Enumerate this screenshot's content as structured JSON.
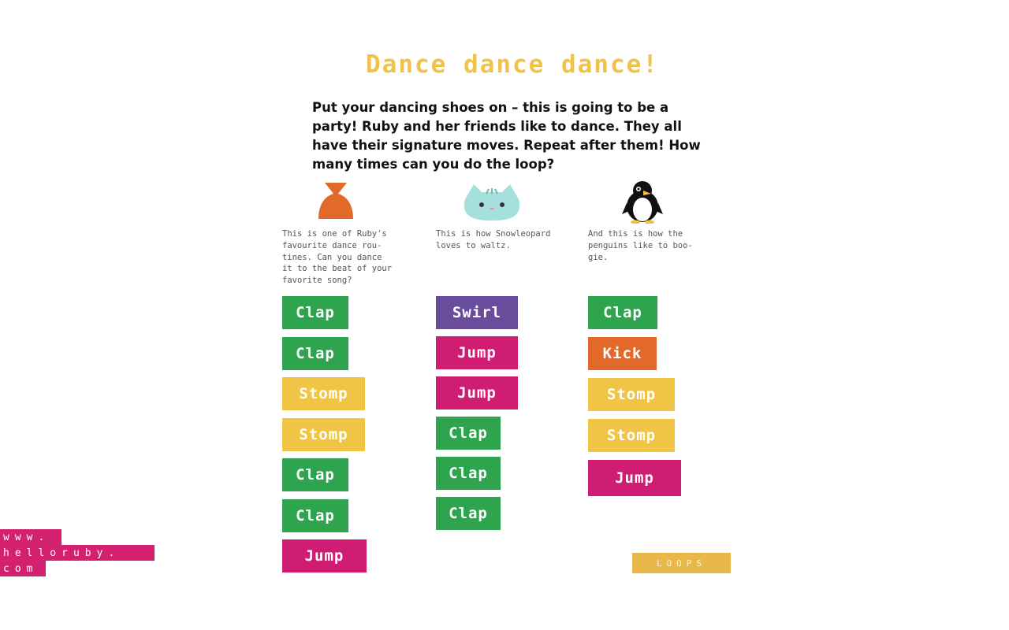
{
  "title": "Dance dance dance!",
  "intro": "Put your dancing shoes on – this is going to be a party! Ruby and her friends like to dance. They all have their signature moves. Repeat after them! How many times can you do the loop?",
  "colors": {
    "title": "#f1c24a",
    "Clap": "#2ea44f",
    "Stomp": "#f0c545",
    "Jump": "#cf1d74",
    "Swirl": "#6a4c9c",
    "Kick": "#e3692a",
    "loops": "#e8b84a",
    "logo": "#d4216f"
  },
  "columns": [
    {
      "icon": "ruby-bow-icon",
      "description": "This is one of  Ruby's\nfavourite dance rou-\ntines. Can you dance\nit to the beat of your\nfavorite song?",
      "moves": [
        "Clap",
        "Clap",
        "Stomp",
        "Stomp",
        "Clap",
        "Clap",
        "Jump"
      ]
    },
    {
      "icon": "snowleopard-icon",
      "description": "This is how Snowleopard\nloves to waltz.",
      "moves": [
        "Swirl",
        "Jump",
        "Jump",
        "Clap",
        "Clap",
        "Clap"
      ]
    },
    {
      "icon": "penguin-icon",
      "description": "And this is how the\npenguins like to boo-\ngie.",
      "moves": [
        "Clap",
        "Kick",
        "Stomp",
        "Stomp",
        "Jump"
      ]
    }
  ],
  "loops_label": "LOOPS",
  "logo": {
    "line1": "www.",
    "line2": "helloruby.",
    "line3": "com"
  }
}
